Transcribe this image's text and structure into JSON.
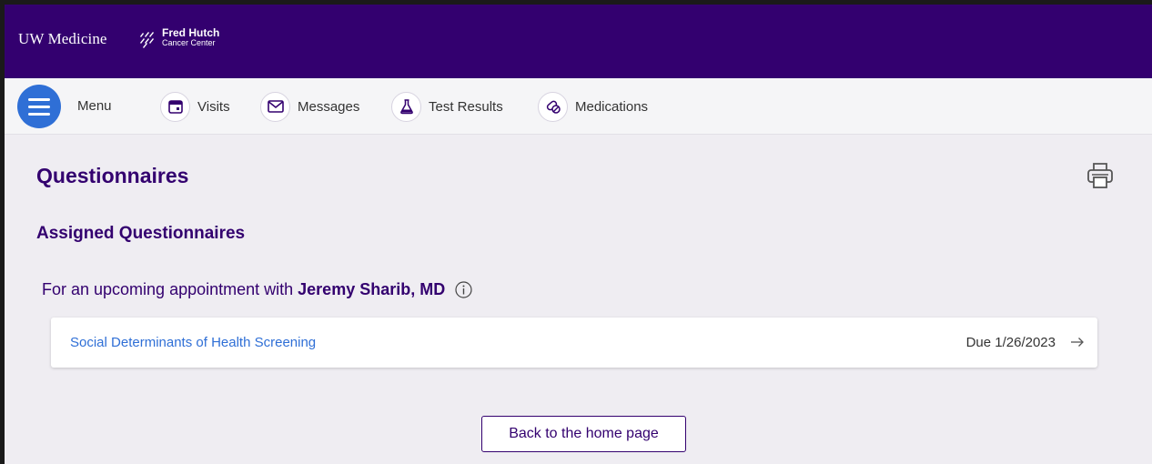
{
  "header": {
    "brand_primary": "UW Medicine",
    "brand_secondary_line1": "Fred Hutch",
    "brand_secondary_line2": "Cancer Center",
    "background_color": "#33006f"
  },
  "nav": {
    "menu_label": "Menu",
    "items": [
      {
        "label": "Visits",
        "icon": "calendar-icon"
      },
      {
        "label": "Messages",
        "icon": "envelope-icon"
      },
      {
        "label": "Test Results",
        "icon": "flask-icon"
      },
      {
        "label": "Medications",
        "icon": "pills-icon"
      }
    ],
    "menu_button_color": "#2f6fd6"
  },
  "main": {
    "title": "Questionnaires",
    "section_title": "Assigned Questionnaires",
    "appointment_prefix": "For an upcoming appointment with",
    "provider_name": "Jeremy Sharib, MD",
    "questionnaires": [
      {
        "name": "Social Determinants of Health Screening",
        "due": "Due 1/26/2023"
      }
    ],
    "back_button_label": "Back to the home page",
    "accent_color": "#33006f",
    "link_color": "#2f6fd6"
  }
}
